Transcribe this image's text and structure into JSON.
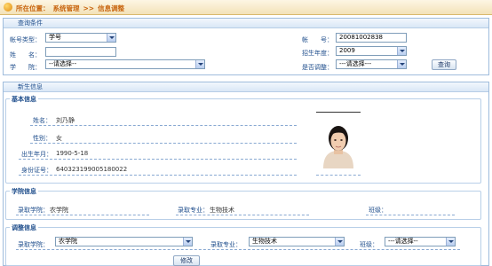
{
  "breadcrumb": {
    "prefix": "所在位置：",
    "section": "系统管理",
    "separator": ">>",
    "page": "信息调整"
  },
  "query": {
    "title": "查询条件",
    "account_type_label": "帐号类型：",
    "account_type_value": "学号",
    "account_label": "帐　　号：",
    "account_value": "20081002838",
    "name_label": "姓　　名：",
    "name_value": "",
    "year_label": "招生年度：",
    "year_value": "2009",
    "college_label": "学　　院：",
    "college_value": "--请选择--",
    "adjusted_label": "是否调整：",
    "adjusted_value": "---请选择---",
    "search_button": "查询"
  },
  "info": {
    "title": "新生信息",
    "basic": {
      "legend": "基本信息",
      "name_label": "姓名：",
      "name_value": "刘乃静",
      "gender_label": "性别：",
      "gender_value": "女",
      "birth_label": "出生年月：",
      "birth_value": "1990-5-18",
      "id_label": "身份证号：",
      "id_value": "640323199005180022"
    },
    "college": {
      "legend": "学院信息",
      "college_label": "录取学院：",
      "college_value": "农学院",
      "major_label": "录取专业：",
      "major_value": "生物技术",
      "class_label": "班级：",
      "class_value": ""
    },
    "adjust": {
      "legend": "调整信息",
      "college_label": "录取学院：",
      "college_value": "农学院",
      "major_label": "录取专业：",
      "major_value": "生物技术",
      "class_label": "班级：",
      "class_value": "---请选择--",
      "modify_button": "修改"
    }
  },
  "colors": {
    "breadcrumb_text": "#c8650f",
    "label_blue": "#1f4e8c",
    "panel_border": "#9fbcdc"
  }
}
